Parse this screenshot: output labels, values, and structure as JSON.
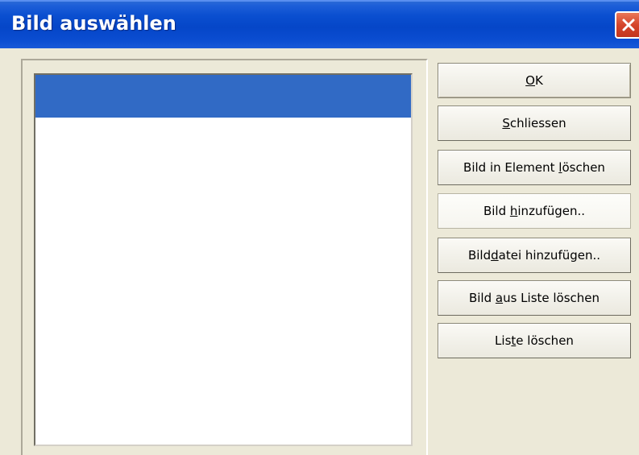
{
  "window": {
    "title": "Bild auswählen"
  },
  "list": {
    "items": [
      ""
    ]
  },
  "buttons": {
    "ok": {
      "pre": "",
      "mnemonic": "O",
      "post": "K"
    },
    "close": {
      "pre": "",
      "mnemonic": "S",
      "post": "chliessen"
    },
    "delete_in_element": {
      "pre": "Bild in Element ",
      "mnemonic": "l",
      "post": "öschen"
    },
    "add_image": {
      "pre": "Bild ",
      "mnemonic": "h",
      "post": "inzufügen.."
    },
    "add_image_file": {
      "pre": "Bild",
      "mnemonic": "d",
      "post": "atei hinzufügen.."
    },
    "delete_from_list": {
      "pre": "Bild ",
      "mnemonic": "a",
      "post": "us Liste löschen"
    },
    "clear_list": {
      "pre": "Lis",
      "mnemonic": "t",
      "post": "e löschen"
    }
  },
  "colors": {
    "titlebar": "#0546c8",
    "selection": "#316ac5",
    "dialog_bg": "#ece9d8",
    "close_button": "#d5452a"
  },
  "icons": {
    "close": "close-icon"
  }
}
